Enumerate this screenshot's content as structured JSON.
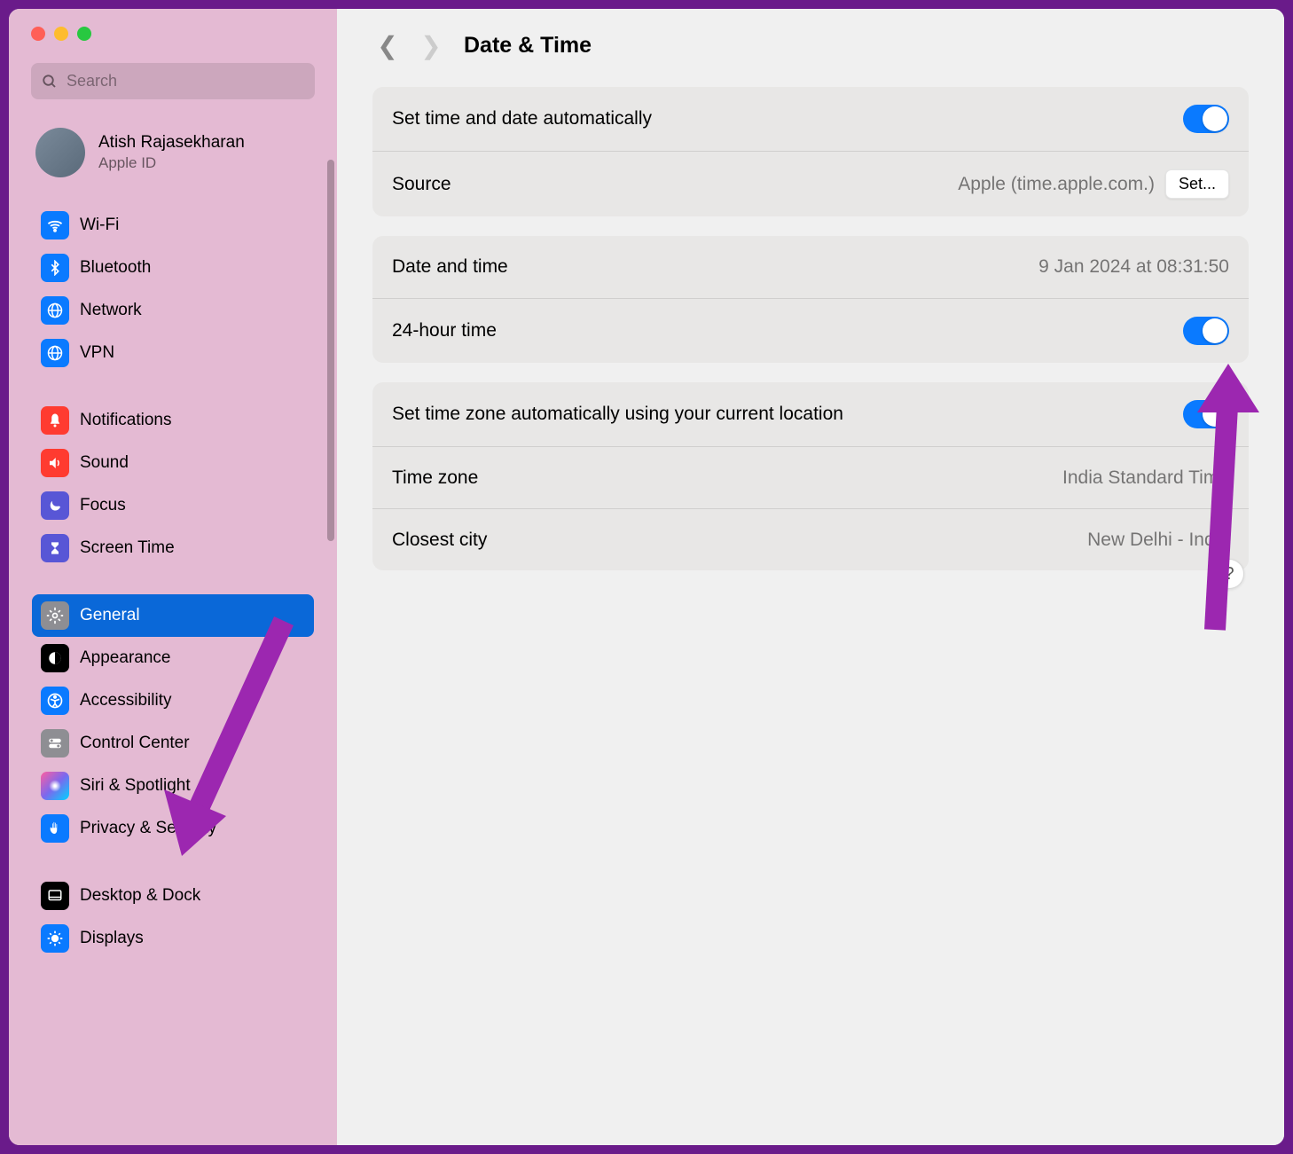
{
  "header": {
    "title": "Date & Time"
  },
  "search": {
    "placeholder": "Search"
  },
  "user": {
    "name": "Atish Rajasekharan",
    "subtitle": "Apple ID"
  },
  "sidebar": {
    "wifi": "Wi-Fi",
    "bluetooth": "Bluetooth",
    "network": "Network",
    "vpn": "VPN",
    "notifications": "Notifications",
    "sound": "Sound",
    "focus": "Focus",
    "screentime": "Screen Time",
    "general": "General",
    "appearance": "Appearance",
    "accessibility": "Accessibility",
    "controlcenter": "Control Center",
    "siri": "Siri & Spotlight",
    "privacy": "Privacy & Security",
    "desktop": "Desktop & Dock",
    "displays": "Displays"
  },
  "settings": {
    "auto_time_label": "Set time and date automatically",
    "source_label": "Source",
    "source_value": "Apple (time.apple.com.)",
    "set_button": "Set...",
    "datetime_label": "Date and time",
    "datetime_value": "9 Jan 2024 at 08:31:50",
    "hour24_label": "24-hour time",
    "auto_tz_label": "Set time zone automatically using your current location",
    "tz_label": "Time zone",
    "tz_value": "India Standard Time",
    "city_label": "Closest city",
    "city_value": "New Delhi - India"
  },
  "help": "?"
}
